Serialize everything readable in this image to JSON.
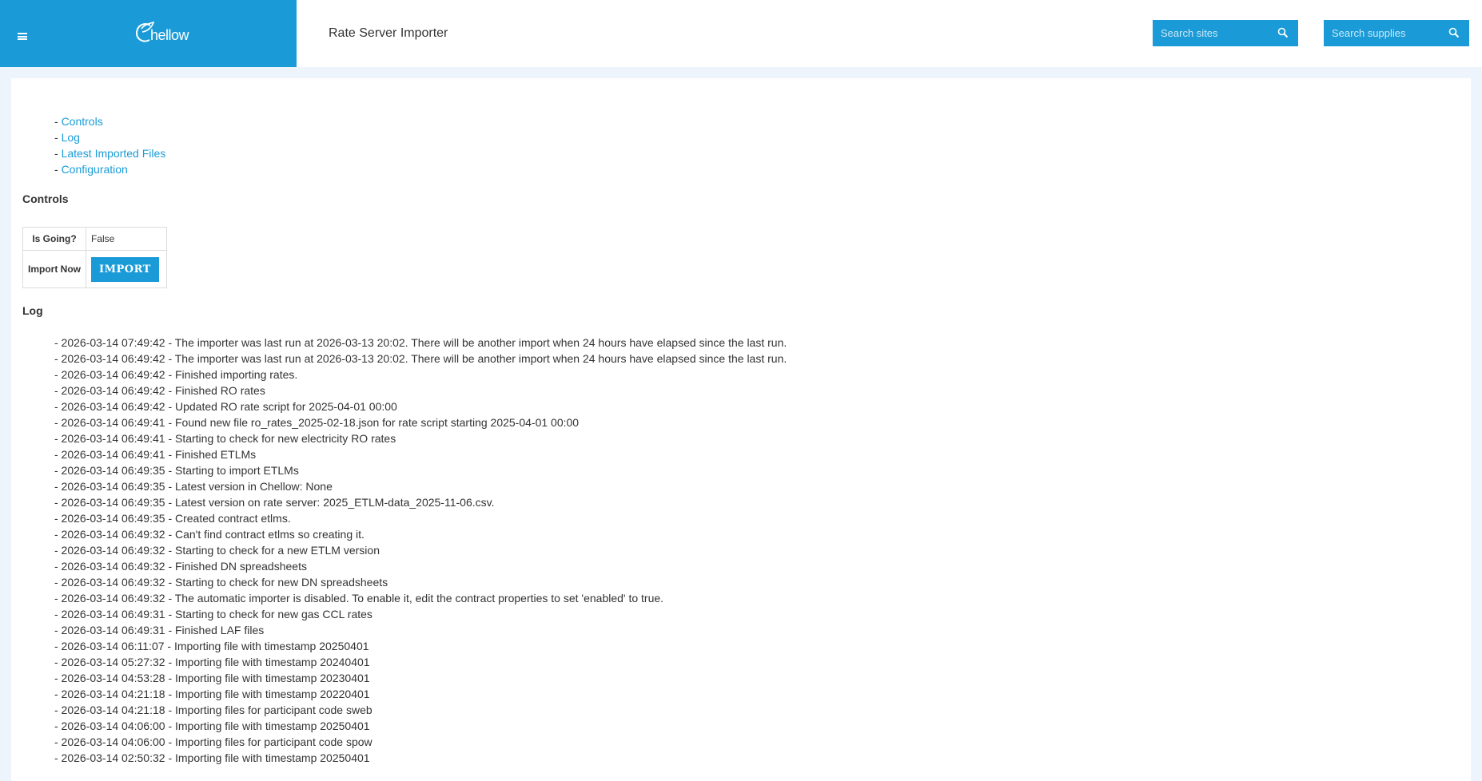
{
  "header": {
    "logo_text": "hellow",
    "page_title": "Rate Server Importer",
    "search_sites_placeholder": "Search sites",
    "search_supplies_placeholder": "Search supplies"
  },
  "toc": [
    {
      "dash": "- ",
      "label": "Controls"
    },
    {
      "dash": "- ",
      "label": "Log"
    },
    {
      "dash": "- ",
      "label": "Latest Imported Files"
    },
    {
      "dash": "- ",
      "label": "Configuration"
    }
  ],
  "controls": {
    "heading": "Controls",
    "is_going_label": "Is Going?",
    "is_going_value": "False",
    "import_now_label": "Import Now",
    "import_button": "IMPORT"
  },
  "log": {
    "heading": "Log",
    "entries": [
      "- 2026-03-14 07:49:42 - The importer was last run at 2026-03-13 20:02. There will be another import when 24 hours have elapsed since the last run.",
      "- 2026-03-14 06:49:42 - The importer was last run at 2026-03-13 20:02. There will be another import when 24 hours have elapsed since the last run.",
      "- 2026-03-14 06:49:42 - Finished importing rates.",
      "- 2026-03-14 06:49:42 - Finished RO rates",
      "- 2026-03-14 06:49:42 - Updated RO rate script for 2025-04-01 00:00",
      "- 2026-03-14 06:49:41 - Found new file ro_rates_2025-02-18.json for rate script starting 2025-04-01 00:00",
      "- 2026-03-14 06:49:41 - Starting to check for new electricity RO rates",
      "- 2026-03-14 06:49:41 - Finished ETLMs",
      "- 2026-03-14 06:49:35 - Starting to import ETLMs",
      "- 2026-03-14 06:49:35 - Latest version in Chellow: None",
      "- 2026-03-14 06:49:35 - Latest version on rate server: 2025_ETLM-data_2025-11-06.csv.",
      "- 2026-03-14 06:49:35 - Created contract etlms.",
      "- 2026-03-14 06:49:32 - Can't find contract etlms so creating it.",
      "- 2026-03-14 06:49:32 - Starting to check for a new ETLM version",
      "- 2026-03-14 06:49:32 - Finished DN spreadsheets",
      "- 2026-03-14 06:49:32 - Starting to check for new DN spreadsheets",
      "- 2026-03-14 06:49:32 - The automatic importer is disabled. To enable it, edit the contract properties to set 'enabled' to true.",
      "- 2026-03-14 06:49:31 - Starting to check for new gas CCL rates",
      "- 2026-03-14 06:49:31 - Finished LAF files",
      "- 2026-03-14 06:11:07 - Importing file with timestamp 20250401",
      "- 2026-03-14 05:27:32 - Importing file with timestamp 20240401",
      "- 2026-03-14 04:53:28 - Importing file with timestamp 20230401",
      "- 2026-03-14 04:21:18 - Importing file with timestamp 20220401",
      "- 2026-03-14 04:21:18 - Importing files for participant code sweb",
      "- 2026-03-14 04:06:00 - Importing file with timestamp 20250401",
      "- 2026-03-14 04:06:00 - Importing files for participant code spow",
      "- 2026-03-14 02:50:32 - Importing file with timestamp 20250401"
    ]
  },
  "icons": {
    "menu": "hamburger-icon",
    "search": "magnifier-icon",
    "logo": "leaf-c-logo"
  },
  "colors": {
    "brand": "#1a9bd8",
    "background": "#eef4fb",
    "link": "#1a9bd8"
  }
}
